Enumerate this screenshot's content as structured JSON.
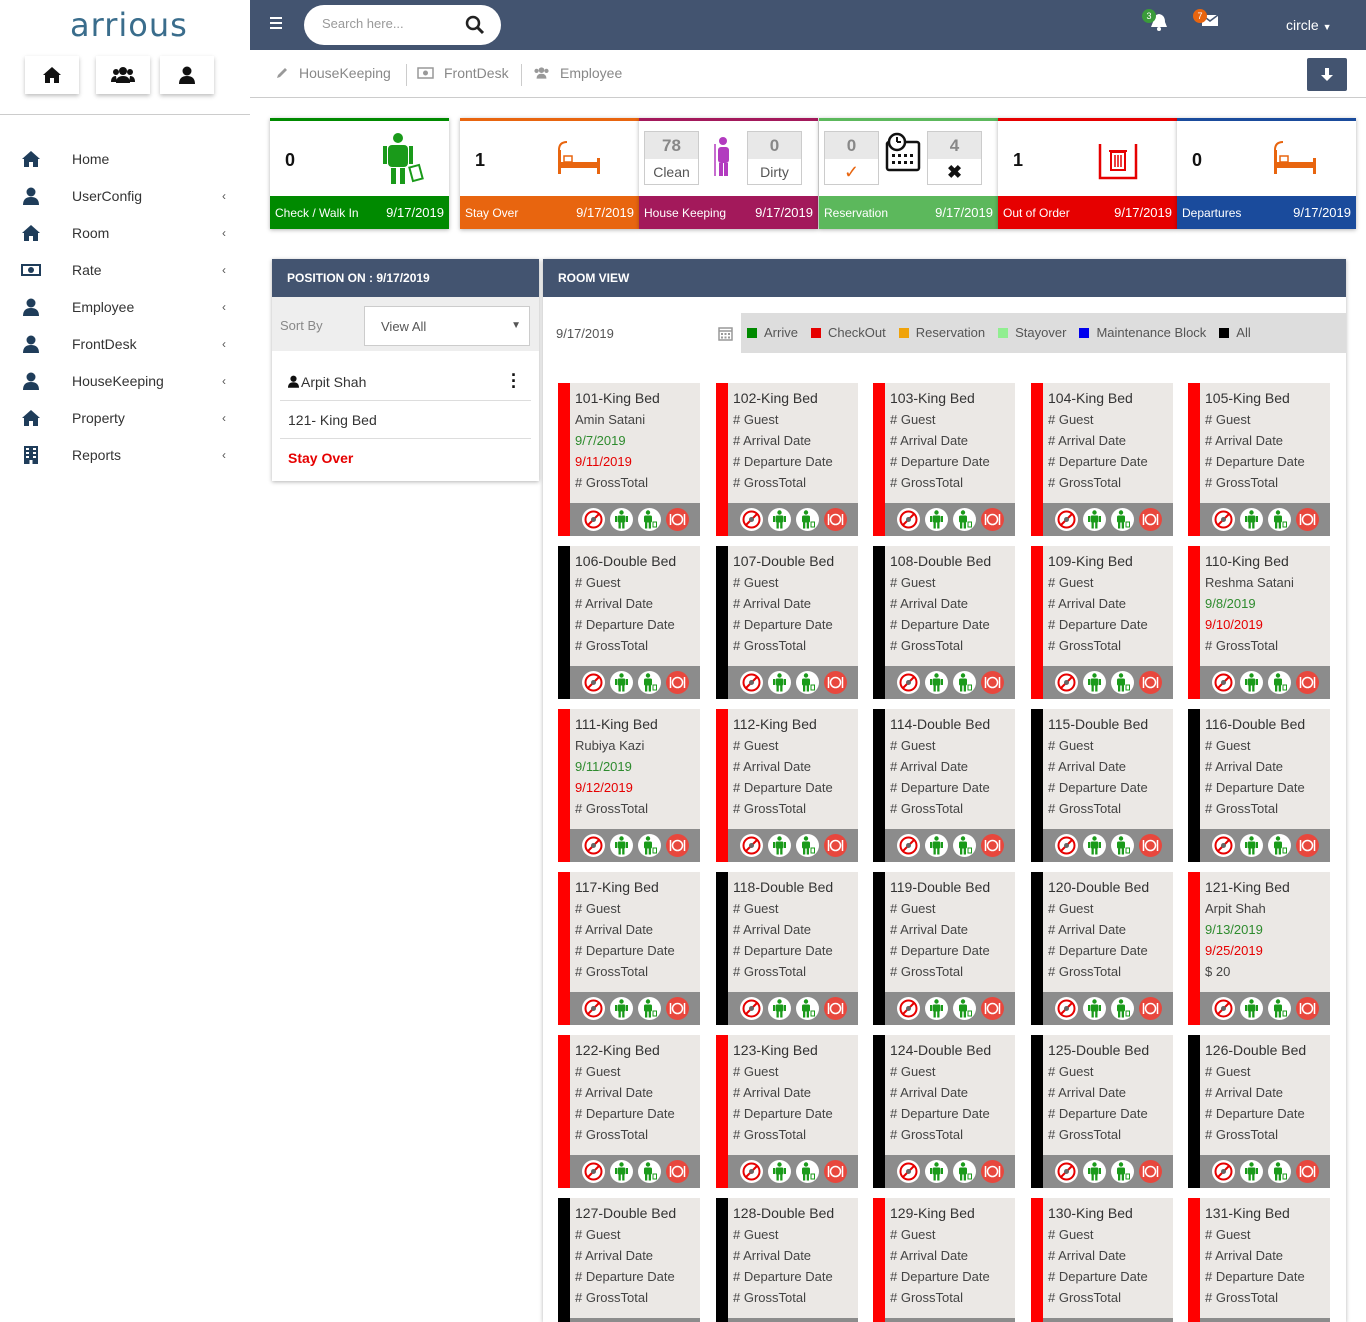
{
  "app": {
    "logo": "arrious",
    "user": "circle",
    "search_placeholder": "Search here...",
    "notif_count": "3",
    "msg_count": "7"
  },
  "quick_icons": [
    "home-icon",
    "group-icon",
    "user-icon"
  ],
  "nav": [
    {
      "label": "Home",
      "icon": "home-icon",
      "chev": ""
    },
    {
      "label": "UserConfig",
      "icon": "user-icon",
      "chev": "‹"
    },
    {
      "label": "Room",
      "icon": "home-icon",
      "chev": "‹"
    },
    {
      "label": "Rate",
      "icon": "money-icon",
      "chev": "‹"
    },
    {
      "label": "Employee",
      "icon": "user-icon",
      "chev": "‹"
    },
    {
      "label": "FrontDesk",
      "icon": "user-icon",
      "chev": "‹"
    },
    {
      "label": "HouseKeeping",
      "icon": "user-icon",
      "chev": "‹"
    },
    {
      "label": "Property",
      "icon": "home-icon",
      "chev": "‹"
    },
    {
      "label": "Reports",
      "icon": "building-icon",
      "chev": "‹"
    }
  ],
  "crumbs": [
    {
      "label": "HouseKeeping",
      "icon": "pencil-icon"
    },
    {
      "label": "FrontDesk",
      "icon": "money-icon"
    },
    {
      "label": "Employee",
      "icon": "group-icon"
    }
  ],
  "cards": {
    "checkin": {
      "value": "0",
      "label": "Check / Walk In",
      "date": "9/17/2019",
      "color": "#008a00"
    },
    "stayover": {
      "value": "1",
      "label": "Stay Over",
      "date": "9/17/2019",
      "color": "#e8650f"
    },
    "housekeeping": {
      "clean": "78",
      "clean_label": "Clean",
      "dirty": "0",
      "dirty_label": "Dirty",
      "label": "House Keeping",
      "date": "9/17/2019",
      "color": "#a3195b"
    },
    "reservation": {
      "ok": "0",
      "cancel": "4",
      "label": "Reservation",
      "date": "9/17/2019",
      "color": "#5cb85c"
    },
    "outoforder": {
      "value": "1",
      "label": "Out of Order",
      "date": "9/17/2019",
      "color": "#e60000"
    },
    "departures": {
      "value": "0",
      "label": "Departures",
      "date": "9/17/2019",
      "color": "#1a4b9c"
    }
  },
  "position": {
    "title": "POSITION ON : 9/17/2019",
    "sort_label": "Sort By",
    "sort_value": "View All",
    "rows": [
      "Arpit Shah",
      "121- King Bed",
      "Stay Over"
    ]
  },
  "roomview": {
    "title": "ROOM VIEW",
    "date": "9/17/2019",
    "legend": [
      {
        "label": "Arrive",
        "color": "#008a00"
      },
      {
        "label": "CheckOut",
        "color": "#e60000"
      },
      {
        "label": "Reservation",
        "color": "#f0a30a"
      },
      {
        "label": "Stayover",
        "color": "#90ee90"
      },
      {
        "label": "Maintenance Block",
        "color": "#0000ee"
      },
      {
        "label": "All",
        "color": "#000000"
      }
    ]
  },
  "rooms": [
    {
      "name": "101-King Bed",
      "strip": "#f00",
      "l1": "Amin Satani",
      "l2": "9/7/2019",
      "l3": "9/11/2019",
      "l4": "# GrossTotal",
      "occ": true
    },
    {
      "name": "102-King Bed",
      "strip": "#f00",
      "l1": "# Guest",
      "l2": "# Arrival Date",
      "l3": "# Departure Date",
      "l4": "# GrossTotal",
      "occ": false
    },
    {
      "name": "103-King Bed",
      "strip": "#f00",
      "l1": "# Guest",
      "l2": "# Arrival Date",
      "l3": "# Departure Date",
      "l4": "# GrossTotal",
      "occ": false
    },
    {
      "name": "104-King Bed",
      "strip": "#f00",
      "l1": "# Guest",
      "l2": "# Arrival Date",
      "l3": "# Departure Date",
      "l4": "# GrossTotal",
      "occ": false
    },
    {
      "name": "105-King Bed",
      "strip": "#f00",
      "l1": "# Guest",
      "l2": "# Arrival Date",
      "l3": "# Departure Date",
      "l4": "# GrossTotal",
      "occ": false
    },
    {
      "name": "106-Double Bed",
      "strip": "#000",
      "l1": "# Guest",
      "l2": "# Arrival Date",
      "l3": "# Departure Date",
      "l4": "# GrossTotal",
      "occ": false
    },
    {
      "name": "107-Double Bed",
      "strip": "#000",
      "l1": "# Guest",
      "l2": "# Arrival Date",
      "l3": "# Departure Date",
      "l4": "# GrossTotal",
      "occ": false
    },
    {
      "name": "108-Double Bed",
      "strip": "#000",
      "l1": "# Guest",
      "l2": "# Arrival Date",
      "l3": "# Departure Date",
      "l4": "# GrossTotal",
      "occ": false
    },
    {
      "name": "109-King Bed",
      "strip": "#f00",
      "l1": "# Guest",
      "l2": "# Arrival Date",
      "l3": "# Departure Date",
      "l4": "# GrossTotal",
      "occ": false
    },
    {
      "name": "110-King Bed",
      "strip": "#f00",
      "l1": "Reshma Satani",
      "l2": "9/8/2019",
      "l3": "9/10/2019",
      "l4": "# GrossTotal",
      "occ": true
    },
    {
      "name": "111-King Bed",
      "strip": "#f00",
      "l1": "Rubiya Kazi",
      "l2": "9/11/2019",
      "l3": "9/12/2019",
      "l4": "# GrossTotal",
      "occ": true
    },
    {
      "name": "112-King Bed",
      "strip": "#f00",
      "l1": "# Guest",
      "l2": "# Arrival Date",
      "l3": "# Departure Date",
      "l4": "# GrossTotal",
      "occ": false
    },
    {
      "name": "114-Double Bed",
      "strip": "#000",
      "l1": "# Guest",
      "l2": "# Arrival Date",
      "l3": "# Departure Date",
      "l4": "# GrossTotal",
      "occ": false
    },
    {
      "name": "115-Double Bed",
      "strip": "#000",
      "l1": "# Guest",
      "l2": "# Arrival Date",
      "l3": "# Departure Date",
      "l4": "# GrossTotal",
      "occ": false
    },
    {
      "name": "116-Double Bed",
      "strip": "#000",
      "l1": "# Guest",
      "l2": "# Arrival Date",
      "l3": "# Departure Date",
      "l4": "# GrossTotal",
      "occ": false
    },
    {
      "name": "117-King Bed",
      "strip": "#f00",
      "l1": "# Guest",
      "l2": "# Arrival Date",
      "l3": "# Departure Date",
      "l4": "# GrossTotal",
      "occ": false
    },
    {
      "name": "118-Double Bed",
      "strip": "#000",
      "l1": "# Guest",
      "l2": "# Arrival Date",
      "l3": "# Departure Date",
      "l4": "# GrossTotal",
      "occ": false
    },
    {
      "name": "119-Double Bed",
      "strip": "#000",
      "l1": "# Guest",
      "l2": "# Arrival Date",
      "l3": "# Departure Date",
      "l4": "# GrossTotal",
      "occ": false
    },
    {
      "name": "120-Double Bed",
      "strip": "#000",
      "l1": "# Guest",
      "l2": "# Arrival Date",
      "l3": "# Departure Date",
      "l4": "# GrossTotal",
      "occ": false
    },
    {
      "name": "121-King Bed",
      "strip": "#f00",
      "l1": "Arpit Shah",
      "l2": "9/13/2019",
      "l3": "9/25/2019",
      "l4": "$ 20",
      "occ": true
    },
    {
      "name": "122-King Bed",
      "strip": "#f00",
      "l1": "# Guest",
      "l2": "# Arrival Date",
      "l3": "# Departure Date",
      "l4": "# GrossTotal",
      "occ": false
    },
    {
      "name": "123-King Bed",
      "strip": "#f00",
      "l1": "# Guest",
      "l2": "# Arrival Date",
      "l3": "# Departure Date",
      "l4": "# GrossTotal",
      "occ": false
    },
    {
      "name": "124-Double Bed",
      "strip": "#000",
      "l1": "# Guest",
      "l2": "# Arrival Date",
      "l3": "# Departure Date",
      "l4": "# GrossTotal",
      "occ": false
    },
    {
      "name": "125-Double Bed",
      "strip": "#000",
      "l1": "# Guest",
      "l2": "# Arrival Date",
      "l3": "# Departure Date",
      "l4": "# GrossTotal",
      "occ": false
    },
    {
      "name": "126-Double Bed",
      "strip": "#000",
      "l1": "# Guest",
      "l2": "# Arrival Date",
      "l3": "# Departure Date",
      "l4": "# GrossTotal",
      "occ": false
    },
    {
      "name": "127-Double Bed",
      "strip": "#000",
      "l1": "# Guest",
      "l2": "# Arrival Date",
      "l3": "# Departure Date",
      "l4": "# GrossTotal",
      "occ": false
    },
    {
      "name": "128-Double Bed",
      "strip": "#000",
      "l1": "# Guest",
      "l2": "# Arrival Date",
      "l3": "# Departure Date",
      "l4": "# GrossTotal",
      "occ": false
    },
    {
      "name": "129-King Bed",
      "strip": "#f00",
      "l1": "# Guest",
      "l2": "# Arrival Date",
      "l3": "# Departure Date",
      "l4": "# GrossTotal",
      "occ": false
    },
    {
      "name": "130-King Bed",
      "strip": "#f00",
      "l1": "# Guest",
      "l2": "# Arrival Date",
      "l3": "# Departure Date",
      "l4": "# GrossTotal",
      "occ": false
    },
    {
      "name": "131-King Bed",
      "strip": "#f00",
      "l1": "# Guest",
      "l2": "# Arrival Date",
      "l3": "# Departure Date",
      "l4": "# GrossTotal",
      "occ": false
    }
  ],
  "room_icons": [
    "no-dnd-icon",
    "person-icon",
    "person-luggage-icon",
    "dining-icon"
  ]
}
